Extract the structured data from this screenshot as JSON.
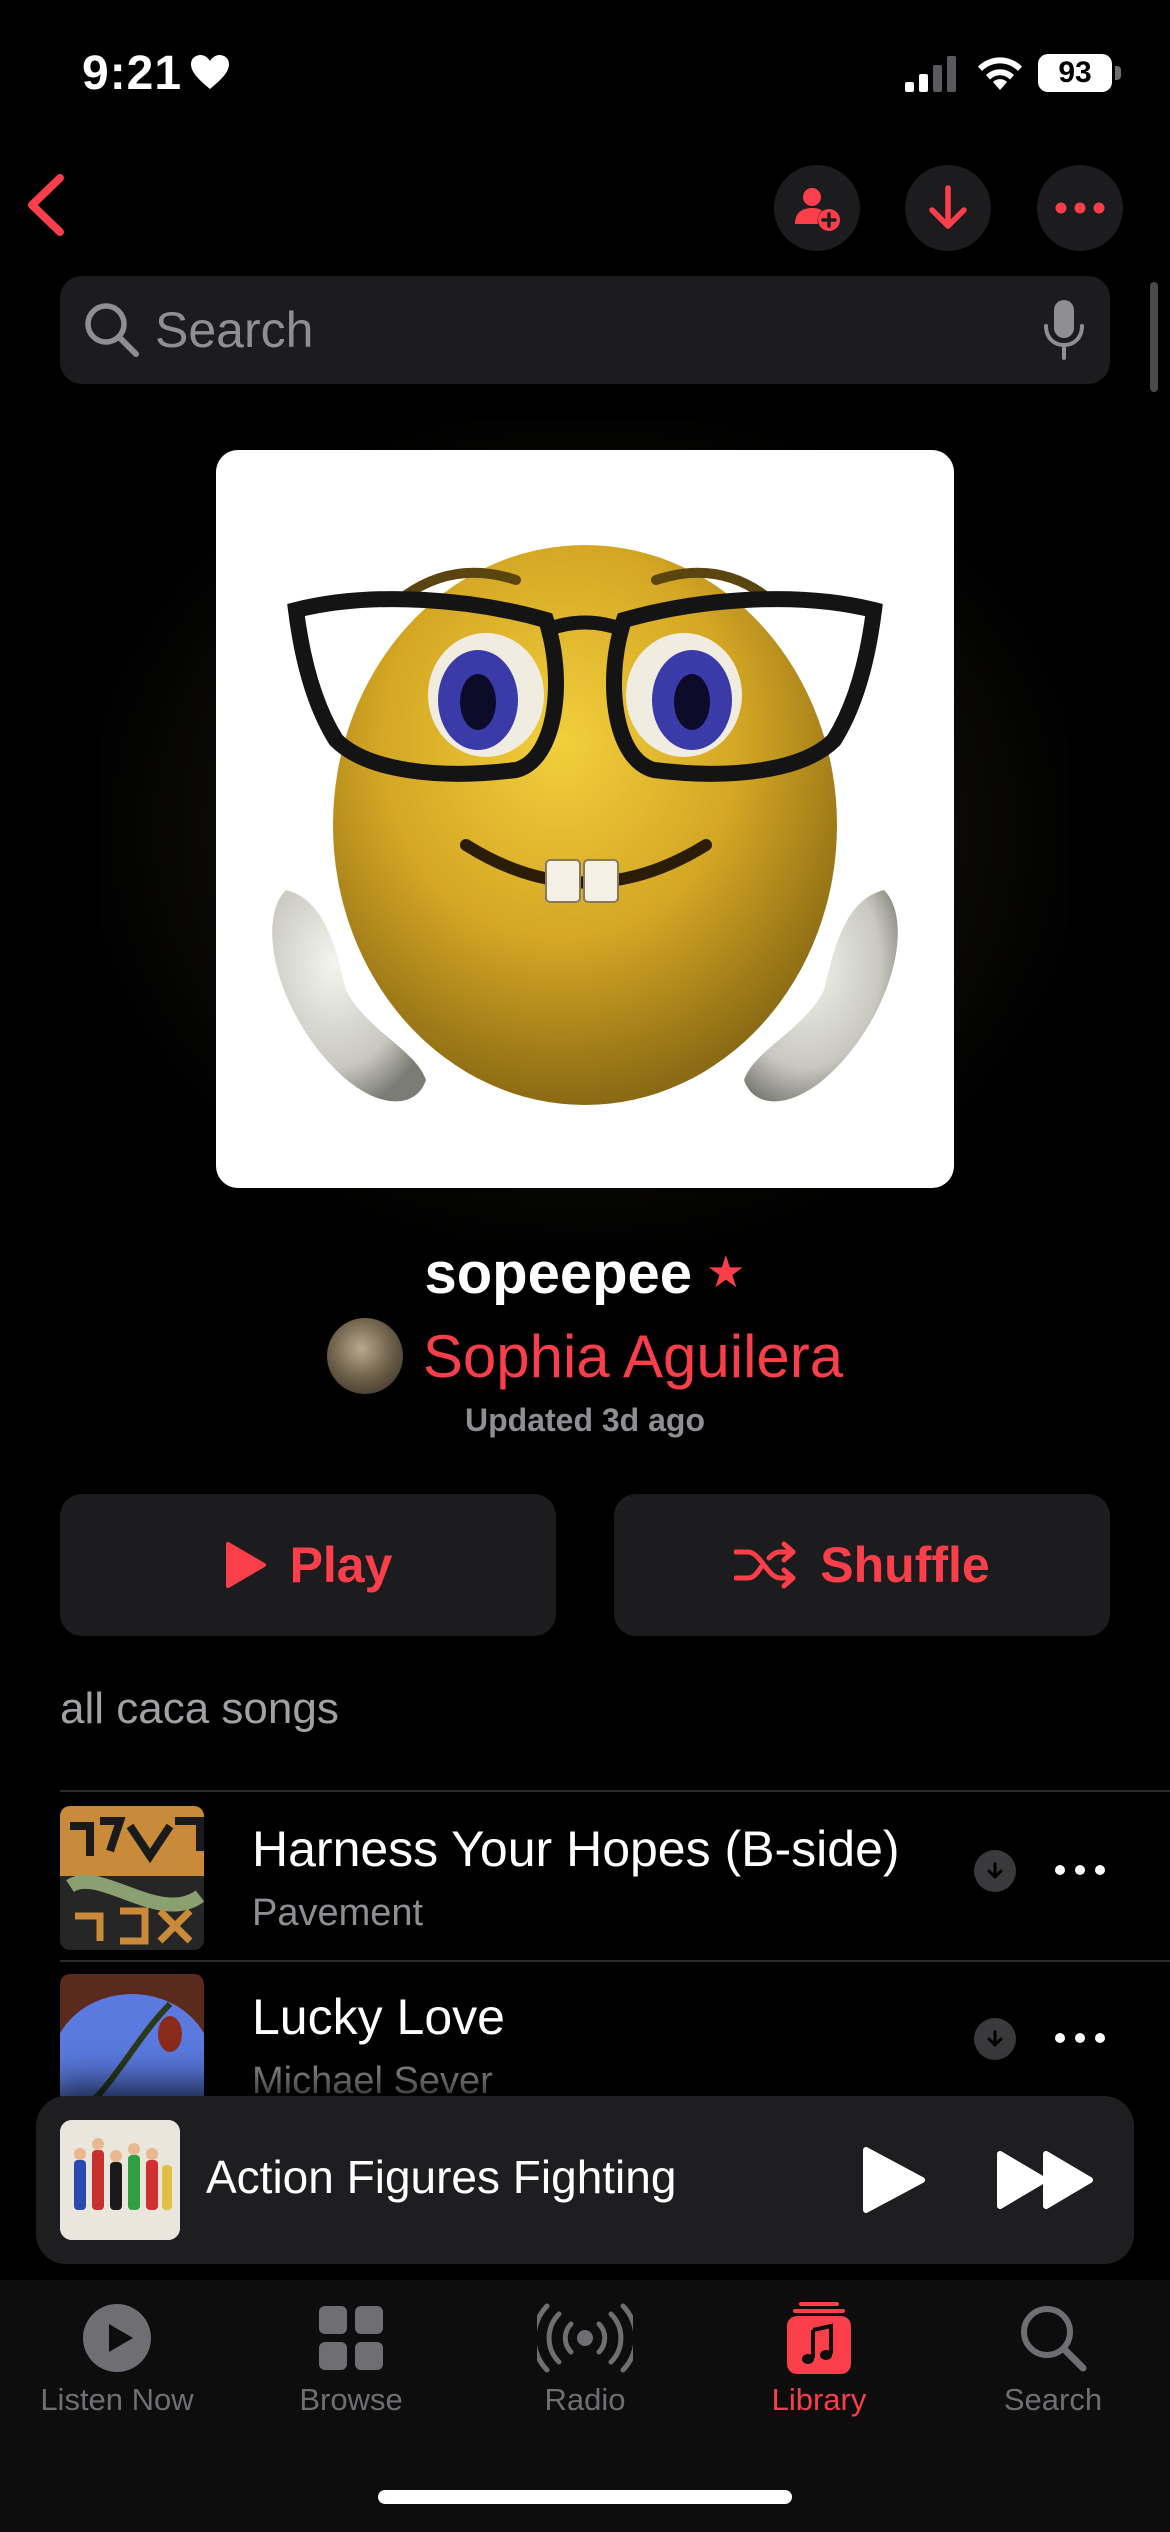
{
  "status_bar": {
    "time": "9:21",
    "battery": "93"
  },
  "header": {
    "back_label": "Back",
    "add_collaborator_label": "Add collaborator",
    "download_label": "Download",
    "more_label": "More"
  },
  "search": {
    "placeholder": "Search"
  },
  "playlist": {
    "title": "sopeepee",
    "author": "Sophia Aguilera",
    "updated": "Updated 3d ago",
    "description": "all caca songs",
    "play_label": "Play",
    "shuffle_label": "Shuffle"
  },
  "songs": [
    {
      "title": "Harness Your Hopes (B-side)",
      "artist": "Pavement",
      "icon": "download-icon"
    },
    {
      "title": "Lucky Love",
      "artist": "Michael Sever",
      "icon": "download-icon"
    }
  ],
  "mini_player": {
    "title": "Action Figures Fighting"
  },
  "tabs": [
    {
      "label": "Listen Now",
      "icon": "play-circle-icon"
    },
    {
      "label": "Browse",
      "icon": "grid-icon"
    },
    {
      "label": "Radio",
      "icon": "radio-waves-icon"
    },
    {
      "label": "Library",
      "icon": "music-note-icon",
      "active": true
    },
    {
      "label": "Search",
      "icon": "search-icon"
    }
  ],
  "colors": {
    "accent": "#fa3e4a",
    "background": "#000000",
    "surface": "#1c1c1e",
    "secondary_text": "#8e8e93"
  }
}
